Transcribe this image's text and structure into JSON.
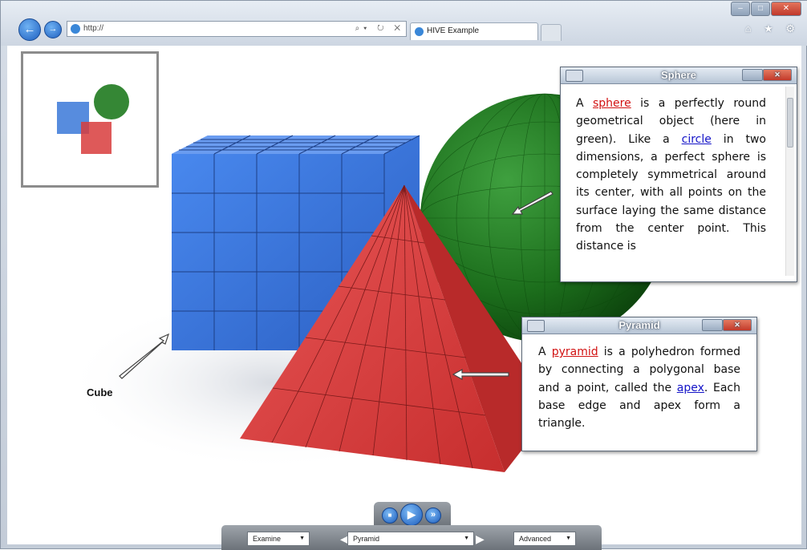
{
  "browser": {
    "address": "http://",
    "tab_title": "HIVE Example",
    "nav_back": "←",
    "nav_forward": "→",
    "address_tools": "⌕▾ ↻ ✕",
    "right_tools": "⌂ ★ ⚙",
    "window_minimize": "–",
    "window_maximize": "□",
    "window_close": "✕"
  },
  "scene": {
    "cube_label": "Cube",
    "colors": {
      "cube": "#3a78d8",
      "sphere": "#1f7a1f",
      "pyramid": "#d83c3c"
    }
  },
  "sphere_panel": {
    "title": "Sphere",
    "text_pre": "A ",
    "link1": "sphere",
    "text_mid1": " is a perfectly round geometrical object (here in green). Like a ",
    "link2": "circle",
    "text_post": " in two dimensions, a perfect sphere is completely symmetrical around its center, with all points on the surface laying the same distance from the center point. This distance is"
  },
  "pyramid_panel": {
    "title": "Pyramid",
    "text_pre": "A ",
    "link1": "pyramid",
    "text_mid1": " is a polyhedron formed by connecting a polygonal base and a point, called the ",
    "link2": "apex",
    "text_post": ". Each base edge and apex form a triangle."
  },
  "controls": {
    "mode": "Examine",
    "viewpoint": "Pyramid",
    "advanced": "Advanced",
    "stop_icon": "■",
    "play_icon": "▶",
    "next_icon": "»"
  }
}
